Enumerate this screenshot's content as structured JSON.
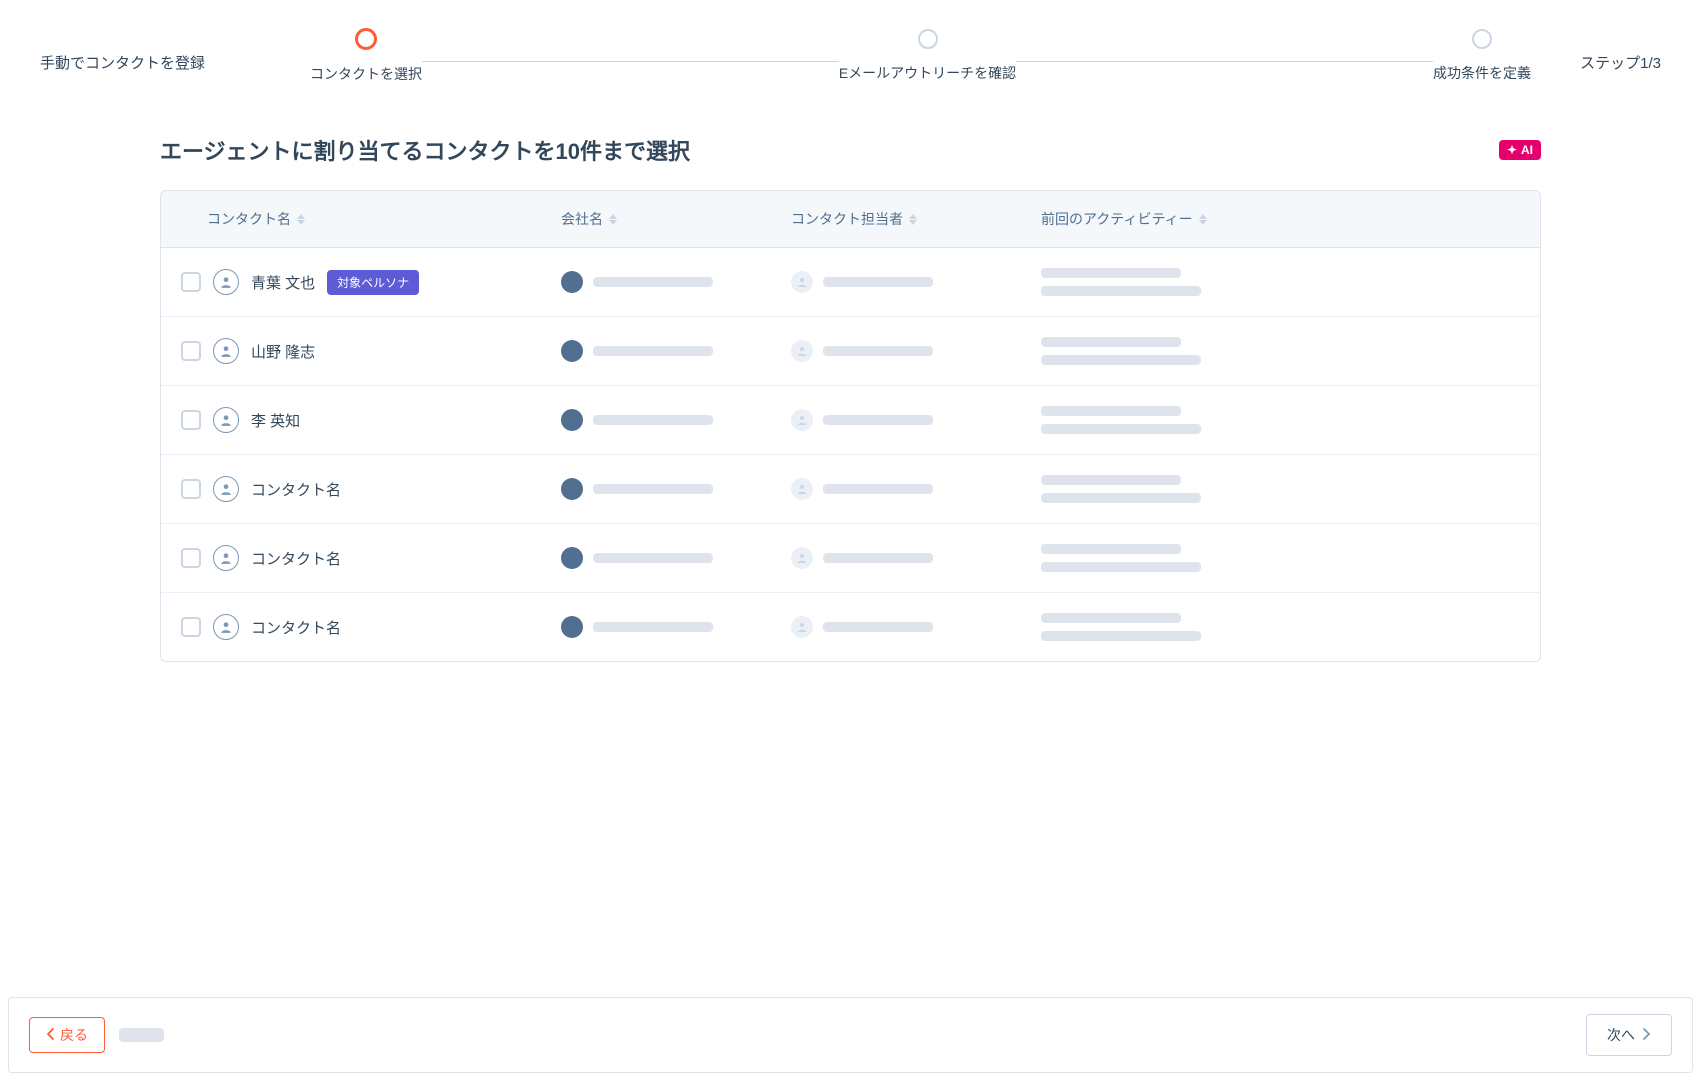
{
  "header": {
    "left_label": "手動でコンタクトを登録",
    "step_indicator": "ステップ1/3",
    "steps": [
      {
        "label": "コンタクトを選択",
        "active": true
      },
      {
        "label": "Eメールアウトリーチを確認",
        "active": false
      },
      {
        "label": "成功条件を定義",
        "active": false
      }
    ]
  },
  "main": {
    "title": "エージェントに割り当てるコンタクトを10件まで選択",
    "ai_badge": "AI",
    "columns": {
      "name": "コンタクト名",
      "company": "会社名",
      "owner": "コンタクト担当者",
      "activity": "前回のアクティビティー"
    },
    "persona_badge_label": "対象ペルソナ",
    "rows": [
      {
        "name": "青葉 文也",
        "persona": true
      },
      {
        "name": "山野 隆志",
        "persona": false
      },
      {
        "name": "李 英知",
        "persona": false
      },
      {
        "name": "コンタクト名",
        "persona": false
      },
      {
        "name": "コンタクト名",
        "persona": false
      },
      {
        "name": "コンタクト名",
        "persona": false
      }
    ]
  },
  "footer": {
    "back": "戻る",
    "next": "次へ"
  }
}
